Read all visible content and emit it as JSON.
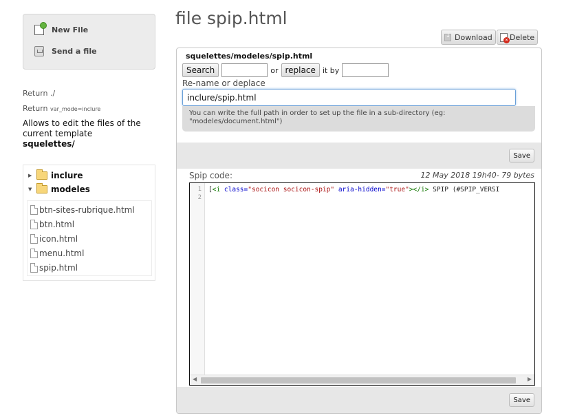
{
  "sidebar": {
    "actions": {
      "new_file": "New File",
      "send_file": "Send a file"
    },
    "return_1": {
      "prefix": "Return",
      "value": "./"
    },
    "return_2": {
      "prefix": "Return",
      "value": "var_mode=inclure"
    },
    "intro_text": "Allows to edit the files of the current template",
    "intro_template": "squelettes/",
    "tree": {
      "folders": [
        {
          "name": "inclure",
          "expanded": false
        },
        {
          "name": "modeles",
          "expanded": true
        }
      ],
      "files": [
        "btn-sites-rubrique.html",
        "btn.html",
        "icon.html",
        "menu.html",
        "spip.html"
      ]
    }
  },
  "main": {
    "title": "file spip.html",
    "download_label": "Download",
    "delete_label": "Delete",
    "path": "squelettes/modeles/spip.html",
    "search": {
      "search_label": "Search",
      "search_value": "",
      "or_word": "or",
      "replace_label": "replace",
      "it_by_word": "it by",
      "replace_value": ""
    },
    "rename_label": "Re-name or deplace",
    "rename_value": "inclure/spip.html",
    "hint": "You can write the full path in order to set up the file in a sub-directory (eg: \"modeles/document.html\")",
    "save_label": "Save",
    "code_label": "Spip code:",
    "code_meta": "12 May 2018 19h40- 79 bytes",
    "line_numbers": [
      "1",
      "2"
    ],
    "code": {
      "open_bracket": "[",
      "tag_open": "<i",
      "attr_class": "class=",
      "val_class": "\"socicon socicon-spip\"",
      "attr_aria": "aria-hidden=",
      "val_aria": "\"true\"",
      "tag_close": "></i>",
      "rest": " SPIP (#SPIP_VERSI"
    }
  }
}
